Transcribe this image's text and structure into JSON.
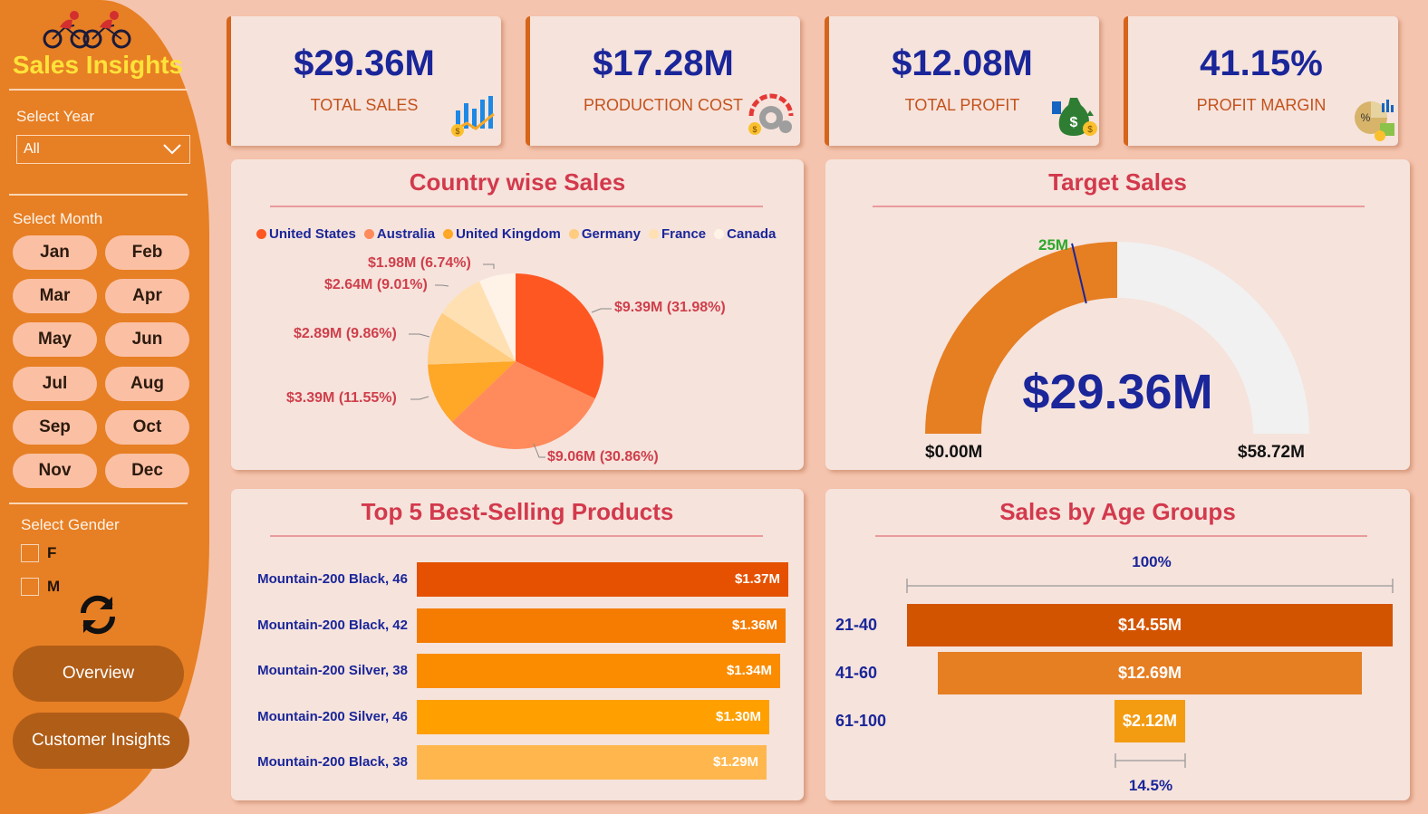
{
  "sidebar": {
    "brand": "Sales Insights",
    "year_label": "Select Year",
    "year_value": "All",
    "month_label": "Select Month",
    "months": [
      "Jan",
      "Feb",
      "Mar",
      "Apr",
      "May",
      "Jun",
      "Jul",
      "Aug",
      "Sep",
      "Oct",
      "Nov",
      "Dec"
    ],
    "gender_label": "Select Gender",
    "genders": [
      "F",
      "M"
    ],
    "nav": [
      "Overview",
      "Customer Insights"
    ]
  },
  "kpis": [
    {
      "value": "$29.36M",
      "label": "TOTAL SALES",
      "icon": "chart-up-icon"
    },
    {
      "value": "$17.28M",
      "label": "PRODUCTION COST",
      "icon": "gear-cost-icon"
    },
    {
      "value": "$12.08M",
      "label": "TOTAL PROFIT",
      "icon": "money-bag-icon"
    },
    {
      "value": "41.15%",
      "label": "PROFIT MARGIN",
      "icon": "pie-percent-icon"
    }
  ],
  "country": {
    "title": "Country wise Sales",
    "legend": [
      {
        "name": "United States",
        "color": "#ff5722"
      },
      {
        "name": "Australia",
        "color": "#ff8a5c"
      },
      {
        "name": "United Kingdom",
        "color": "#ffa726"
      },
      {
        "name": "Germany",
        "color": "#ffcc80"
      },
      {
        "name": "France",
        "color": "#ffe0b2"
      },
      {
        "name": "Canada",
        "color": "#fff3e8"
      }
    ],
    "labels": [
      "$9.39M (31.98%)",
      "$9.06M (30.86%)",
      "$3.39M (11.55%)",
      "$2.89M (9.86%)",
      "$2.64M (9.01%)",
      "$1.98M (6.74%)"
    ]
  },
  "target": {
    "title": "Target Sales",
    "value": "$29.36M",
    "target_label": "25M",
    "min": "$0.00M",
    "max": "$58.72M"
  },
  "products": {
    "title": "Top 5 Best-Selling Products",
    "items": [
      {
        "name": "Mountain-200 Black, 46",
        "value": "$1.37M"
      },
      {
        "name": "Mountain-200 Black, 42",
        "value": "$1.36M"
      },
      {
        "name": "Mountain-200 Silver, 38",
        "value": "$1.34M"
      },
      {
        "name": "Mountain-200 Silver, 46",
        "value": "$1.30M"
      },
      {
        "name": "Mountain-200 Black, 38",
        "value": "$1.29M"
      }
    ]
  },
  "ages": {
    "title": "Sales by Age Groups",
    "top_pct": "100%",
    "bottom_pct": "14.5%",
    "items": [
      {
        "group": "21-40",
        "value": "$14.55M"
      },
      {
        "group": "41-60",
        "value": "$12.69M"
      },
      {
        "group": "61-100",
        "value": "$2.12M"
      }
    ]
  },
  "chart_data": [
    {
      "type": "pie",
      "title": "Country wise Sales",
      "categories": [
        "United States",
        "Australia",
        "United Kingdom",
        "Germany",
        "France",
        "Canada"
      ],
      "values": [
        9.39,
        9.06,
        3.39,
        2.89,
        2.64,
        1.98
      ],
      "percents": [
        31.98,
        30.86,
        11.55,
        9.86,
        9.01,
        6.74
      ],
      "colors": [
        "#ff5722",
        "#ff8a5c",
        "#ffa726",
        "#ffcc80",
        "#ffe0b2",
        "#fff3e8"
      ],
      "legend": "top"
    },
    {
      "type": "gauge",
      "title": "Target Sales",
      "value": 29.36,
      "target": 25,
      "min": 0,
      "max": 58.72,
      "unit": "$M"
    },
    {
      "type": "bar",
      "title": "Top 5 Best-Selling Products",
      "categories": [
        "Mountain-200 Black, 46",
        "Mountain-200 Black, 42",
        "Mountain-200 Silver, 38",
        "Mountain-200 Silver, 46",
        "Mountain-200 Black, 38"
      ],
      "values": [
        1.37,
        1.36,
        1.34,
        1.3,
        1.29
      ],
      "colors": [
        "#e55100",
        "#f57c00",
        "#fb8c00",
        "#ffa000",
        "#ffb74d"
      ]
    },
    {
      "type": "funnel",
      "title": "Sales by Age Groups",
      "categories": [
        "21-40",
        "41-60",
        "61-100"
      ],
      "values": [
        14.55,
        12.69,
        2.12
      ],
      "colors": [
        "#d35400",
        "#e67e22",
        "#f39c12"
      ]
    }
  ]
}
